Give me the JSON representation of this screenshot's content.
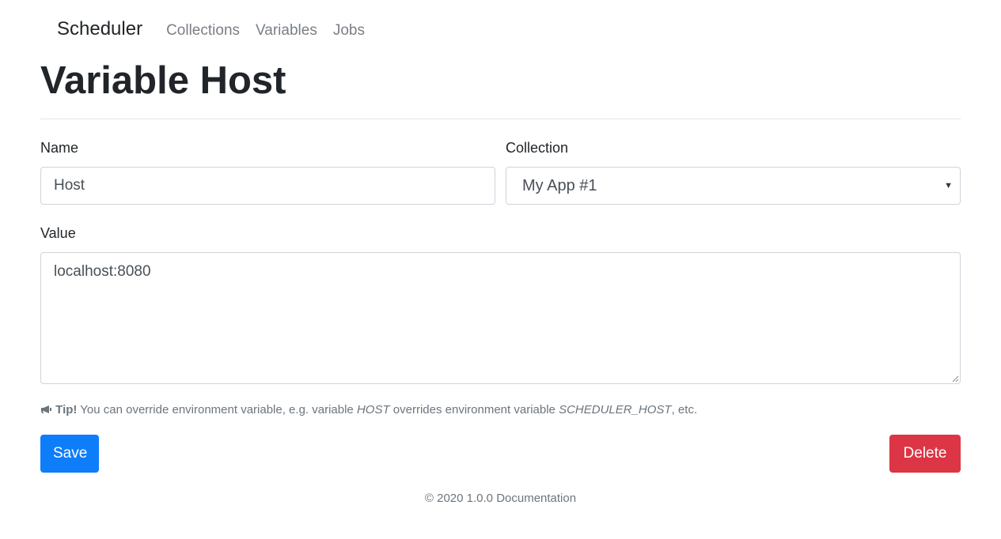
{
  "nav": {
    "brand": "Scheduler",
    "links": [
      "Collections",
      "Variables",
      "Jobs"
    ]
  },
  "page": {
    "title": "Variable Host"
  },
  "form": {
    "name_label": "Name",
    "name_value": "Host",
    "collection_label": "Collection",
    "collection_value": "My App #1",
    "value_label": "Value",
    "value_value": "localhost:8080"
  },
  "tip": {
    "icon": "megaphone-icon",
    "strong": "Tip!",
    "text_1": " You can override environment variable, e.g. variable ",
    "em_1": "HOST",
    "text_2": " overrides environment variable ",
    "em_2": "SCHEDULER_HOST",
    "text_3": ", etc."
  },
  "buttons": {
    "save": "Save",
    "delete": "Delete"
  },
  "footer": {
    "copyright": "© 2020 1.0.0",
    "docs_link": "Documentation"
  },
  "colors": {
    "primary": "#0d7dfa",
    "danger": "#dc3545"
  }
}
